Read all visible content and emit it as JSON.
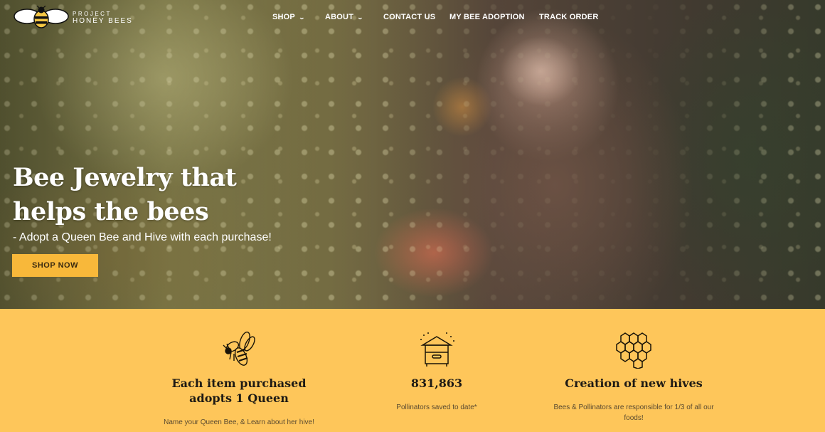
{
  "header": {
    "logo": {
      "line1": "PROJECT",
      "line2": "HONEY BEES"
    },
    "nav": [
      {
        "label": "SHOP",
        "has_dropdown": true
      },
      {
        "label": "ABOUT",
        "has_dropdown": true
      },
      {
        "label": "CONTACT US",
        "has_dropdown": false
      },
      {
        "label": "MY BEE ADOPTION",
        "has_dropdown": false
      },
      {
        "label": "TRACK ORDER",
        "has_dropdown": false
      }
    ],
    "chevron": "⌄"
  },
  "hero": {
    "title": "Bee Jewelry that helps the bees",
    "subtitle": "- Adopt a Queen Bee and Hive with each purchase!",
    "cta_label": "SHOP NOW"
  },
  "features": [
    {
      "icon": "queen-bee-icon",
      "title": "Each item purchased adopts 1 Queen",
      "description": "Name your Queen Bee, & Learn about her hive!"
    },
    {
      "icon": "beehive-icon",
      "title": "831,863",
      "description": "Pollinators saved to date*"
    },
    {
      "icon": "honeycomb-icon",
      "title": "Creation of new hives",
      "description": "Bees & Pollinators are responsible for 1/3 of all our foods!"
    }
  ],
  "colors": {
    "band": "#fec65a",
    "cta": "#f8b83a",
    "text_dark": "#1e1a14"
  }
}
